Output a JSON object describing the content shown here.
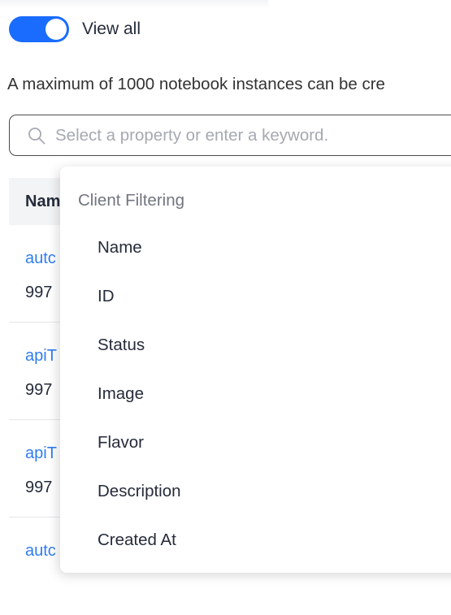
{
  "toggle": {
    "label": "View all",
    "on": true,
    "color": "#1a6cff"
  },
  "info_text": "A maximum of 1000 notebook instances can be cre",
  "search": {
    "placeholder": "Select a property or enter a keyword.",
    "icon": "search-icon"
  },
  "table": {
    "header_label": "Nam",
    "rows": [
      {
        "link": "autc",
        "sub": "997"
      },
      {
        "link": "apiT",
        "sub": "997"
      },
      {
        "link": "apiT",
        "sub": "997"
      },
      {
        "link": "autc",
        "sub": ""
      }
    ]
  },
  "dropdown": {
    "group_label": "Client Filtering",
    "items": [
      "Name",
      "ID",
      "Status",
      "Image",
      "Flavor",
      "Description",
      "Created At"
    ]
  },
  "colors": {
    "accent": "#1a6cff",
    "link": "#2f7df0",
    "placeholder": "#a5a9b1"
  }
}
